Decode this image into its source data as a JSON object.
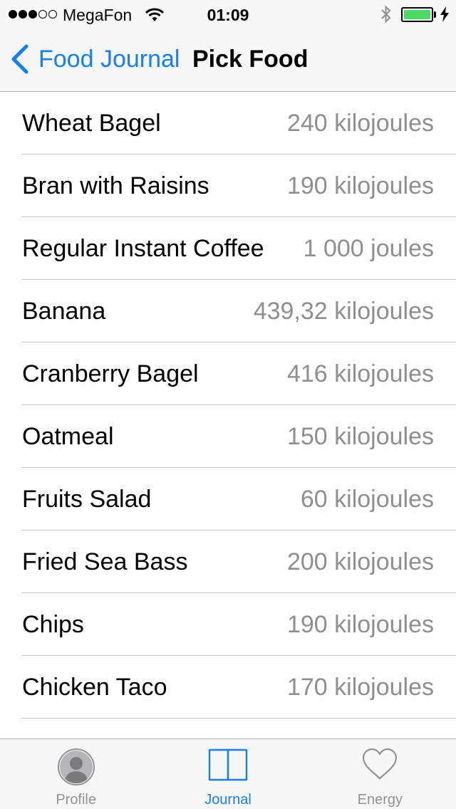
{
  "status_bar": {
    "carrier": "MegaFon",
    "time": "01:09",
    "signal_strength": 3,
    "signal_max": 5,
    "battery_color": "#4cd964"
  },
  "nav": {
    "back_label": "Food Journal",
    "title": "Pick Food",
    "accent_color": "#157efb"
  },
  "foods": [
    {
      "name": "Wheat Bagel",
      "energy": "240 kilojoules"
    },
    {
      "name": "Bran with Raisins",
      "energy": "190 kilojoules"
    },
    {
      "name": "Regular Instant Coffee",
      "energy": "1 000 joules"
    },
    {
      "name": "Banana",
      "energy": "439,32 kilojoules"
    },
    {
      "name": "Cranberry Bagel",
      "energy": "416 kilojoules"
    },
    {
      "name": "Oatmeal",
      "energy": "150 kilojoules"
    },
    {
      "name": "Fruits Salad",
      "energy": "60 kilojoules"
    },
    {
      "name": "Fried Sea Bass",
      "energy": "200 kilojoules"
    },
    {
      "name": "Chips",
      "energy": "190 kilojoules"
    },
    {
      "name": "Chicken Taco",
      "energy": "170 kilojoules"
    }
  ],
  "tabs": [
    {
      "label": "Profile",
      "icon": "profile-icon",
      "active": false
    },
    {
      "label": "Journal",
      "icon": "journal-icon",
      "active": true
    },
    {
      "label": "Energy",
      "icon": "heart-icon",
      "active": false
    }
  ]
}
